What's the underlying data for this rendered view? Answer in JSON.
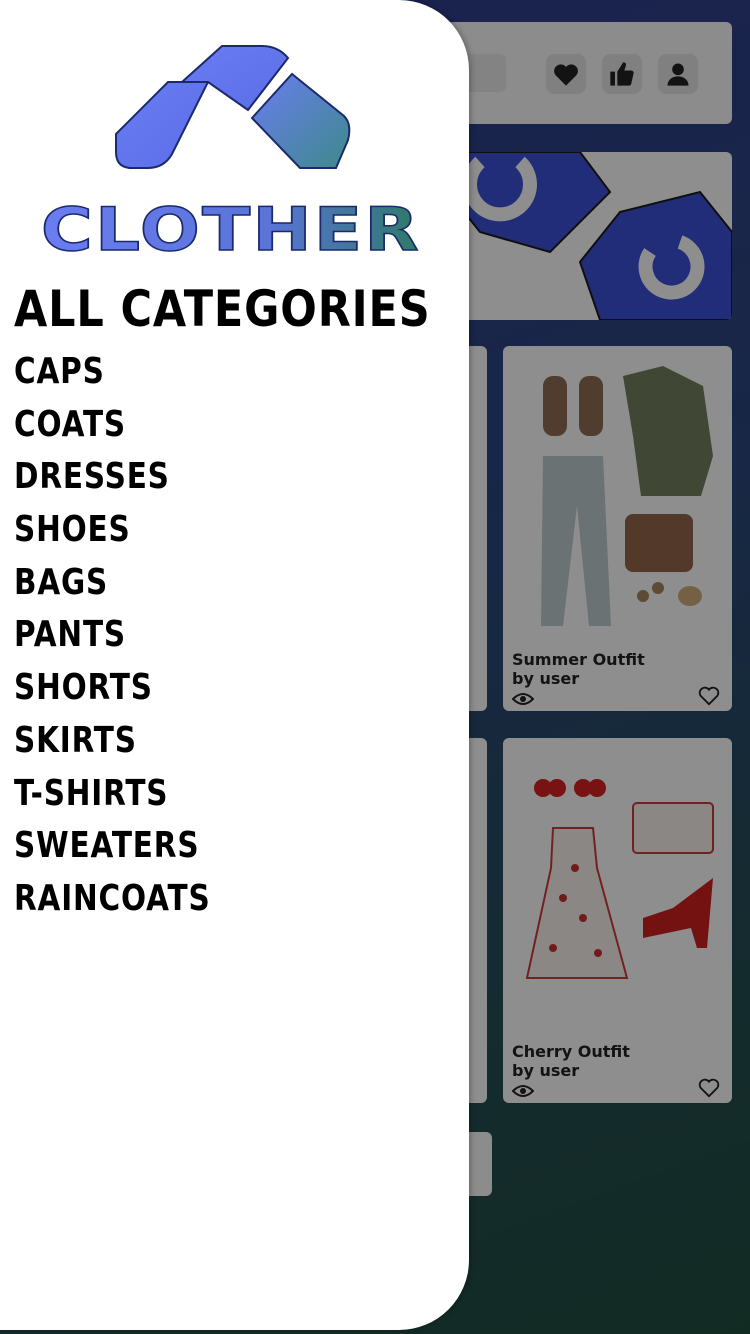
{
  "app": {
    "brand": "CLOTHER"
  },
  "drawer": {
    "heading": "ALL CATEGORIES",
    "categories": [
      "CAPS",
      "COATS",
      "DRESSES",
      "SHOES",
      "BAGS",
      "PANTS",
      "SHORTS",
      "SKIRTS",
      "T-SHIRTS",
      "SWEATERS",
      "RAINCOATS"
    ]
  },
  "feed": {
    "cards": [
      {
        "title": "Summer Outfit",
        "author": "by user"
      },
      {
        "title": "Cherry Outfit",
        "author": "by user"
      }
    ]
  },
  "topbar": {
    "icons": [
      "heart-icon",
      "thumbs-up-icon",
      "user-icon"
    ]
  },
  "colors": {
    "brand_blue": "#6478f0",
    "brand_green": "#2e7a66",
    "overlay": "#000000"
  }
}
